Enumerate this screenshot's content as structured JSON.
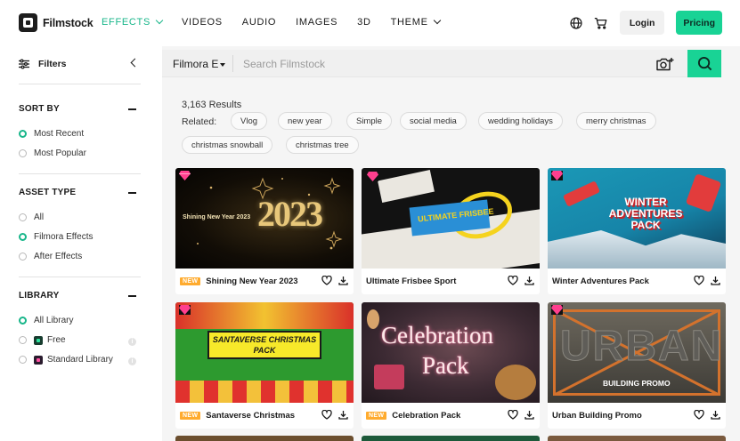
{
  "brand": {
    "name": "Filmstock"
  },
  "nav": {
    "items": [
      {
        "label": "EFFECTS",
        "active": true,
        "has_menu": true
      },
      {
        "label": "VIDEOS",
        "active": false,
        "has_menu": false
      },
      {
        "label": "AUDIO",
        "active": false,
        "has_menu": false
      },
      {
        "label": "IMAGES",
        "active": false,
        "has_menu": false
      },
      {
        "label": "3D",
        "active": false,
        "has_menu": false
      },
      {
        "label": "THEME",
        "active": false,
        "has_menu": true
      }
    ],
    "login_label": "Login",
    "pricing_label": "Pricing",
    "accent_color": "#18b68a",
    "cta_color": "#19d395"
  },
  "sidebar": {
    "filters_label": "Filters",
    "sort_by": {
      "title": "SORT BY",
      "options": [
        {
          "label": "Most Recent",
          "selected": true
        },
        {
          "label": "Most Popular",
          "selected": false
        }
      ]
    },
    "asset_type": {
      "title": "ASSET TYPE",
      "options": [
        {
          "label": "All",
          "selected": false
        },
        {
          "label": "Filmora Effects",
          "selected": true
        },
        {
          "label": "After Effects",
          "selected": false
        }
      ]
    },
    "library": {
      "title": "LIBRARY",
      "options": [
        {
          "label": "All Library",
          "selected": true,
          "badge": ""
        },
        {
          "label": "Free",
          "selected": false,
          "badge": "free-badge-icon"
        },
        {
          "label": "Standard Library",
          "selected": false,
          "badge": "standard-badge-icon"
        }
      ]
    }
  },
  "search": {
    "scope_label": "Filmora E",
    "placeholder": "Search Filmstock",
    "value": ""
  },
  "results": {
    "count_text": "3,163 Results",
    "related_label": "Related:",
    "related_tags": [
      "Vlog",
      "new year",
      "Simple",
      "social media",
      "wedding holidays",
      "merry christmas",
      "christmas snowball",
      "christmas tree"
    ],
    "new_badge_label": "NEW",
    "cards": [
      {
        "title": "Shining New Year 2023",
        "is_new": true,
        "thumb_text": "Shining New Year 2023",
        "thumb_big": "2023"
      },
      {
        "title": "Ultimate Frisbee Sport",
        "is_new": false,
        "thumb_text": "ULTIMATE FRISBEE",
        "thumb_big": ""
      },
      {
        "title": "Winter Adventures Pack",
        "is_new": false,
        "thumb_text": "WINTER ADVENTURES PACK",
        "thumb_big": ""
      },
      {
        "title": "Santaverse Christmas",
        "is_new": true,
        "thumb_text": "SANTAVERSE CHRISTMAS PACK",
        "thumb_big": ""
      },
      {
        "title": "Celebration Pack",
        "is_new": true,
        "thumb_text": "Celebration",
        "thumb_big": "Pack"
      },
      {
        "title": "Urban Building Promo",
        "is_new": false,
        "thumb_text": "BUILDING PROMO",
        "thumb_big": "URBAN"
      }
    ]
  }
}
